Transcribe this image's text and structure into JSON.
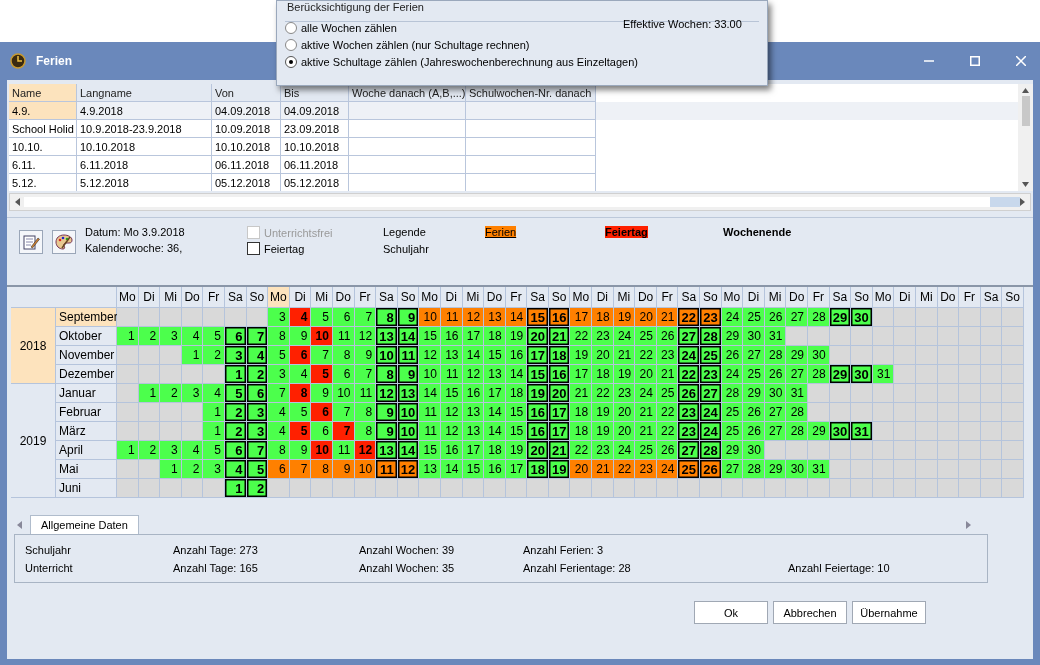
{
  "popup": {
    "title": "Berücksichtigung der Ferien",
    "effective": "Effektive Wochen: 33.00",
    "options": [
      {
        "label": "alle Wochen zählen",
        "selected": false
      },
      {
        "label": "aktive Wochen zählen (nur Schultage rechnen)",
        "selected": false
      },
      {
        "label": "aktive Schultage zählen (Jahreswochenberechnung aus Einzeltagen)",
        "selected": true
      }
    ]
  },
  "window": {
    "title": "Ferien"
  },
  "table": {
    "columns": [
      "Name",
      "Langname",
      "Von",
      "Bis",
      "Woche danach (A,B,...)",
      "Schulwochen-Nr. danach"
    ],
    "rows": [
      {
        "selected": true,
        "cells": [
          "4.9.",
          "4.9.2018",
          "04.09.2018",
          "04.09.2018"
        ]
      },
      {
        "selected": false,
        "cells": [
          "School Holid",
          "10.9.2018-23.9.2018",
          "10.09.2018",
          "23.09.2018"
        ]
      },
      {
        "selected": false,
        "cells": [
          "10.10.",
          "10.10.2018",
          "10.10.2018",
          "10.10.2018"
        ]
      },
      {
        "selected": false,
        "cells": [
          "6.11.",
          "6.11.2018",
          "06.11.2018",
          "06.11.2018"
        ]
      },
      {
        "selected": false,
        "cells": [
          "5.12.",
          "5.12.2018",
          "05.12.2018",
          "05.12.2018"
        ]
      }
    ]
  },
  "toolbar": {
    "date": "Datum: Mo 3.9.2018",
    "week": "Kalenderwoche: 36,",
    "checkboxes": [
      {
        "label": "Unterrichtsfrei",
        "checked": false,
        "disabled": true
      },
      {
        "label": "Feiertag",
        "checked": false,
        "disabled": false
      }
    ],
    "legend": [
      {
        "label": "Legende",
        "kind": "plain"
      },
      {
        "label": "Ferien",
        "kind": "holiday"
      },
      {
        "label": "Feiertag",
        "kind": "public_holiday"
      },
      {
        "label": "Wochenende",
        "kind": "weekend"
      },
      {
        "label": "Schuljahr",
        "kind": "plain"
      }
    ]
  },
  "calendar": {
    "weekdays": [
      {
        "label": "Mo",
        "selected": false
      },
      {
        "label": "Di",
        "selected": false
      },
      {
        "label": "Mi",
        "selected": false
      },
      {
        "label": "Do",
        "selected": false
      },
      {
        "label": "Fr",
        "selected": false
      },
      {
        "label": "Sa",
        "selected": false
      },
      {
        "label": "So",
        "selected": false
      },
      {
        "label": "Mo",
        "selected": true
      },
      {
        "label": "Di",
        "selected": false
      },
      {
        "label": "Mi",
        "selected": false
      },
      {
        "label": "Do",
        "selected": false
      },
      {
        "label": "Fr",
        "selected": false
      },
      {
        "label": "Sa",
        "selected": false
      },
      {
        "label": "So",
        "selected": false
      },
      {
        "label": "Mo",
        "selected": false
      },
      {
        "label": "Di",
        "selected": false
      },
      {
        "label": "Mi",
        "selected": false
      },
      {
        "label": "Do",
        "selected": false
      },
      {
        "label": "Fr",
        "selected": false
      },
      {
        "label": "Sa",
        "selected": false
      },
      {
        "label": "So",
        "selected": false
      },
      {
        "label": "Mo",
        "selected": false
      },
      {
        "label": "Di",
        "selected": false
      },
      {
        "label": "Mi",
        "selected": false
      },
      {
        "label": "Do",
        "selected": false
      },
      {
        "label": "Fr",
        "selected": false
      },
      {
        "label": "Sa",
        "selected": false
      },
      {
        "label": "So",
        "selected": false
      },
      {
        "label": "Mo",
        "selected": false
      },
      {
        "label": "Di",
        "selected": false
      },
      {
        "label": "Mi",
        "selected": false
      },
      {
        "label": "Do",
        "selected": false
      },
      {
        "label": "Fr",
        "selected": false
      },
      {
        "label": "Sa",
        "selected": false
      },
      {
        "label": "So",
        "selected": false
      },
      {
        "label": "Mo",
        "selected": false
      },
      {
        "label": "Di",
        "selected": false
      },
      {
        "label": "Mi",
        "selected": false
      },
      {
        "label": "Do",
        "selected": false
      },
      {
        "label": "Fr",
        "selected": false
      },
      {
        "label": "Sa",
        "selected": false
      },
      {
        "label": "So",
        "selected": false
      }
    ],
    "years": [
      {
        "year": "2018",
        "selected": true,
        "months": [
          {
            "name": "September",
            "selected": true,
            "cells": [
              {
                "kind": "empty"
              },
              {
                "kind": "empty"
              },
              {
                "kind": "empty"
              },
              {
                "kind": "empty"
              },
              {
                "kind": "empty"
              },
              {
                "kind": "empty"
              },
              {
                "kind": "empty"
              },
              {
                "day": "3",
                "kind": "school"
              },
              {
                "day": "4",
                "kind": "public_holiday"
              },
              {
                "day": "5",
                "kind": "school"
              },
              {
                "day": "6",
                "kind": "school"
              },
              {
                "day": "7",
                "kind": "school"
              },
              {
                "day": "8",
                "kind": "weekend"
              },
              {
                "day": "9",
                "kind": "weekend"
              },
              {
                "day": "10",
                "kind": "holiday"
              },
              {
                "day": "11",
                "kind": "holiday"
              },
              {
                "day": "12",
                "kind": "holiday"
              },
              {
                "day": "13",
                "kind": "holiday"
              },
              {
                "day": "14",
                "kind": "holiday"
              },
              {
                "day": "15",
                "kind": "holiday_weekend"
              },
              {
                "day": "16",
                "kind": "holiday_weekend"
              },
              {
                "day": "17",
                "kind": "holiday"
              },
              {
                "day": "18",
                "kind": "holiday"
              },
              {
                "day": "19",
                "kind": "holiday"
              },
              {
                "day": "20",
                "kind": "holiday"
              },
              {
                "day": "21",
                "kind": "holiday"
              },
              {
                "day": "22",
                "kind": "holiday_weekend"
              },
              {
                "day": "23",
                "kind": "holiday_weekend"
              },
              {
                "day": "24",
                "kind": "school"
              },
              {
                "day": "25",
                "kind": "school"
              },
              {
                "day": "26",
                "kind": "school"
              },
              {
                "day": "27",
                "kind": "school"
              },
              {
                "day": "28",
                "kind": "school"
              },
              {
                "day": "29",
                "kind": "weekend"
              },
              {
                "day": "30",
                "kind": "weekend"
              }
            ]
          },
          {
            "name": "Oktober",
            "selected": false,
            "cells": [
              {
                "day": "1",
                "kind": "school"
              },
              {
                "day": "2",
                "kind": "school"
              },
              {
                "day": "3",
                "kind": "school"
              },
              {
                "day": "4",
                "kind": "school"
              },
              {
                "day": "5",
                "kind": "school"
              },
              {
                "day": "6",
                "kind": "weekend"
              },
              {
                "day": "7",
                "kind": "weekend"
              },
              {
                "day": "8",
                "kind": "school"
              },
              {
                "day": "9",
                "kind": "school"
              },
              {
                "day": "10",
                "kind": "public_holiday"
              },
              {
                "day": "11",
                "kind": "school"
              },
              {
                "day": "12",
                "kind": "school"
              },
              {
                "day": "13",
                "kind": "weekend"
              },
              {
                "day": "14",
                "kind": "weekend"
              },
              {
                "day": "15",
                "kind": "school"
              },
              {
                "day": "16",
                "kind": "school"
              },
              {
                "day": "17",
                "kind": "school"
              },
              {
                "day": "18",
                "kind": "school"
              },
              {
                "day": "19",
                "kind": "school"
              },
              {
                "day": "20",
                "kind": "weekend"
              },
              {
                "day": "21",
                "kind": "weekend"
              },
              {
                "day": "22",
                "kind": "school"
              },
              {
                "day": "23",
                "kind": "school"
              },
              {
                "day": "24",
                "kind": "school"
              },
              {
                "day": "25",
                "kind": "school"
              },
              {
                "day": "26",
                "kind": "school"
              },
              {
                "day": "27",
                "kind": "weekend"
              },
              {
                "day": "28",
                "kind": "weekend"
              },
              {
                "day": "29",
                "kind": "school"
              },
              {
                "day": "30",
                "kind": "school"
              },
              {
                "day": "31",
                "kind": "school"
              }
            ]
          },
          {
            "name": "November",
            "selected": false,
            "cells": [
              {
                "kind": "empty"
              },
              {
                "kind": "empty"
              },
              {
                "kind": "empty"
              },
              {
                "day": "1",
                "kind": "school"
              },
              {
                "day": "2",
                "kind": "school"
              },
              {
                "day": "3",
                "kind": "weekend"
              },
              {
                "day": "4",
                "kind": "weekend"
              },
              {
                "day": "5",
                "kind": "school"
              },
              {
                "day": "6",
                "kind": "public_holiday"
              },
              {
                "day": "7",
                "kind": "school"
              },
              {
                "day": "8",
                "kind": "school"
              },
              {
                "day": "9",
                "kind": "school"
              },
              {
                "day": "10",
                "kind": "weekend"
              },
              {
                "day": "11",
                "kind": "weekend"
              },
              {
                "day": "12",
                "kind": "school"
              },
              {
                "day": "13",
                "kind": "school"
              },
              {
                "day": "14",
                "kind": "school"
              },
              {
                "day": "15",
                "kind": "school"
              },
              {
                "day": "16",
                "kind": "school"
              },
              {
                "day": "17",
                "kind": "weekend"
              },
              {
                "day": "18",
                "kind": "weekend"
              },
              {
                "day": "19",
                "kind": "school"
              },
              {
                "day": "20",
                "kind": "school"
              },
              {
                "day": "21",
                "kind": "school"
              },
              {
                "day": "22",
                "kind": "school"
              },
              {
                "day": "23",
                "kind": "school"
              },
              {
                "day": "24",
                "kind": "weekend"
              },
              {
                "day": "25",
                "kind": "weekend"
              },
              {
                "day": "26",
                "kind": "school"
              },
              {
                "day": "27",
                "kind": "school"
              },
              {
                "day": "28",
                "kind": "school"
              },
              {
                "day": "29",
                "kind": "school"
              },
              {
                "day": "30",
                "kind": "school"
              }
            ]
          },
          {
            "name": "Dezember",
            "selected": false,
            "cells": [
              {
                "kind": "empty"
              },
              {
                "kind": "empty"
              },
              {
                "kind": "empty"
              },
              {
                "kind": "empty"
              },
              {
                "kind": "empty"
              },
              {
                "day": "1",
                "kind": "weekend"
              },
              {
                "day": "2",
                "kind": "weekend"
              },
              {
                "day": "3",
                "kind": "school"
              },
              {
                "day": "4",
                "kind": "school"
              },
              {
                "day": "5",
                "kind": "public_holiday"
              },
              {
                "day": "6",
                "kind": "school"
              },
              {
                "day": "7",
                "kind": "school"
              },
              {
                "day": "8",
                "kind": "weekend"
              },
              {
                "day": "9",
                "kind": "weekend"
              },
              {
                "day": "10",
                "kind": "school"
              },
              {
                "day": "11",
                "kind": "school"
              },
              {
                "day": "12",
                "kind": "school"
              },
              {
                "day": "13",
                "kind": "school"
              },
              {
                "day": "14",
                "kind": "school"
              },
              {
                "day": "15",
                "kind": "weekend"
              },
              {
                "day": "16",
                "kind": "weekend"
              },
              {
                "day": "17",
                "kind": "school"
              },
              {
                "day": "18",
                "kind": "school"
              },
              {
                "day": "19",
                "kind": "school"
              },
              {
                "day": "20",
                "kind": "school"
              },
              {
                "day": "21",
                "kind": "school"
              },
              {
                "day": "22",
                "kind": "weekend"
              },
              {
                "day": "23",
                "kind": "weekend"
              },
              {
                "day": "24",
                "kind": "school"
              },
              {
                "day": "25",
                "kind": "school"
              },
              {
                "day": "26",
                "kind": "school"
              },
              {
                "day": "27",
                "kind": "school"
              },
              {
                "day": "28",
                "kind": "school"
              },
              {
                "day": "29",
                "kind": "weekend"
              },
              {
                "day": "30",
                "kind": "weekend"
              },
              {
                "day": "31",
                "kind": "school"
              }
            ]
          }
        ]
      },
      {
        "year": "2019",
        "selected": false,
        "months": [
          {
            "name": "Januar",
            "selected": false,
            "cells": [
              {
                "kind": "empty"
              },
              {
                "day": "1",
                "kind": "school"
              },
              {
                "day": "2",
                "kind": "school"
              },
              {
                "day": "3",
                "kind": "school"
              },
              {
                "day": "4",
                "kind": "school"
              },
              {
                "day": "5",
                "kind": "weekend"
              },
              {
                "day": "6",
                "kind": "weekend"
              },
              {
                "day": "7",
                "kind": "school"
              },
              {
                "day": "8",
                "kind": "public_holiday"
              },
              {
                "day": "9",
                "kind": "school"
              },
              {
                "day": "10",
                "kind": "school"
              },
              {
                "day": "11",
                "kind": "school"
              },
              {
                "day": "12",
                "kind": "weekend"
              },
              {
                "day": "13",
                "kind": "weekend"
              },
              {
                "day": "14",
                "kind": "school"
              },
              {
                "day": "15",
                "kind": "school"
              },
              {
                "day": "16",
                "kind": "school"
              },
              {
                "day": "17",
                "kind": "school"
              },
              {
                "day": "18",
                "kind": "school"
              },
              {
                "day": "19",
                "kind": "weekend"
              },
              {
                "day": "20",
                "kind": "weekend"
              },
              {
                "day": "21",
                "kind": "school"
              },
              {
                "day": "22",
                "kind": "school"
              },
              {
                "day": "23",
                "kind": "school"
              },
              {
                "day": "24",
                "kind": "school"
              },
              {
                "day": "25",
                "kind": "school"
              },
              {
                "day": "26",
                "kind": "weekend"
              },
              {
                "day": "27",
                "kind": "weekend"
              },
              {
                "day": "28",
                "kind": "school"
              },
              {
                "day": "29",
                "kind": "school"
              },
              {
                "day": "30",
                "kind": "school"
              },
              {
                "day": "31",
                "kind": "school"
              }
            ]
          },
          {
            "name": "Februar",
            "selected": false,
            "cells": [
              {
                "kind": "empty"
              },
              {
                "kind": "empty"
              },
              {
                "kind": "empty"
              },
              {
                "kind": "empty"
              },
              {
                "day": "1",
                "kind": "school"
              },
              {
                "day": "2",
                "kind": "weekend"
              },
              {
                "day": "3",
                "kind": "weekend"
              },
              {
                "day": "4",
                "kind": "school"
              },
              {
                "day": "5",
                "kind": "school"
              },
              {
                "day": "6",
                "kind": "public_holiday"
              },
              {
                "day": "7",
                "kind": "school"
              },
              {
                "day": "8",
                "kind": "school"
              },
              {
                "day": "9",
                "kind": "weekend"
              },
              {
                "day": "10",
                "kind": "weekend"
              },
              {
                "day": "11",
                "kind": "school"
              },
              {
                "day": "12",
                "kind": "school"
              },
              {
                "day": "13",
                "kind": "school"
              },
              {
                "day": "14",
                "kind": "school"
              },
              {
                "day": "15",
                "kind": "school"
              },
              {
                "day": "16",
                "kind": "weekend"
              },
              {
                "day": "17",
                "kind": "weekend"
              },
              {
                "day": "18",
                "kind": "school"
              },
              {
                "day": "19",
                "kind": "school"
              },
              {
                "day": "20",
                "kind": "school"
              },
              {
                "day": "21",
                "kind": "school"
              },
              {
                "day": "22",
                "kind": "school"
              },
              {
                "day": "23",
                "kind": "weekend"
              },
              {
                "day": "24",
                "kind": "weekend"
              },
              {
                "day": "25",
                "kind": "school"
              },
              {
                "day": "26",
                "kind": "school"
              },
              {
                "day": "27",
                "kind": "school"
              },
              {
                "day": "28",
                "kind": "school"
              }
            ]
          },
          {
            "name": "März",
            "selected": false,
            "cells": [
              {
                "kind": "empty"
              },
              {
                "kind": "empty"
              },
              {
                "kind": "empty"
              },
              {
                "kind": "empty"
              },
              {
                "day": "1",
                "kind": "school"
              },
              {
                "day": "2",
                "kind": "weekend"
              },
              {
                "day": "3",
                "kind": "weekend"
              },
              {
                "day": "4",
                "kind": "school"
              },
              {
                "day": "5",
                "kind": "public_holiday"
              },
              {
                "day": "6",
                "kind": "school"
              },
              {
                "day": "7",
                "kind": "public_holiday"
              },
              {
                "day": "8",
                "kind": "school"
              },
              {
                "day": "9",
                "kind": "weekend"
              },
              {
                "day": "10",
                "kind": "weekend"
              },
              {
                "day": "11",
                "kind": "school"
              },
              {
                "day": "12",
                "kind": "school"
              },
              {
                "day": "13",
                "kind": "school"
              },
              {
                "day": "14",
                "kind": "school"
              },
              {
                "day": "15",
                "kind": "school"
              },
              {
                "day": "16",
                "kind": "weekend"
              },
              {
                "day": "17",
                "kind": "weekend"
              },
              {
                "day": "18",
                "kind": "school"
              },
              {
                "day": "19",
                "kind": "school"
              },
              {
                "day": "20",
                "kind": "school"
              },
              {
                "day": "21",
                "kind": "school"
              },
              {
                "day": "22",
                "kind": "school"
              },
              {
                "day": "23",
                "kind": "weekend"
              },
              {
                "day": "24",
                "kind": "weekend"
              },
              {
                "day": "25",
                "kind": "school"
              },
              {
                "day": "26",
                "kind": "school"
              },
              {
                "day": "27",
                "kind": "school"
              },
              {
                "day": "28",
                "kind": "school"
              },
              {
                "day": "29",
                "kind": "school"
              },
              {
                "day": "30",
                "kind": "weekend"
              },
              {
                "day": "31",
                "kind": "weekend"
              }
            ]
          },
          {
            "name": "April",
            "selected": false,
            "cells": [
              {
                "day": "1",
                "kind": "school"
              },
              {
                "day": "2",
                "kind": "school"
              },
              {
                "day": "3",
                "kind": "school"
              },
              {
                "day": "4",
                "kind": "school"
              },
              {
                "day": "5",
                "kind": "school"
              },
              {
                "day": "6",
                "kind": "weekend"
              },
              {
                "day": "7",
                "kind": "weekend"
              },
              {
                "day": "8",
                "kind": "school"
              },
              {
                "day": "9",
                "kind": "school"
              },
              {
                "day": "10",
                "kind": "public_holiday"
              },
              {
                "day": "11",
                "kind": "school"
              },
              {
                "day": "12",
                "kind": "public_holiday"
              },
              {
                "day": "13",
                "kind": "weekend"
              },
              {
                "day": "14",
                "kind": "weekend"
              },
              {
                "day": "15",
                "kind": "school"
              },
              {
                "day": "16",
                "kind": "school"
              },
              {
                "day": "17",
                "kind": "school"
              },
              {
                "day": "18",
                "kind": "school"
              },
              {
                "day": "19",
                "kind": "school"
              },
              {
                "day": "20",
                "kind": "weekend"
              },
              {
                "day": "21",
                "kind": "weekend"
              },
              {
                "day": "22",
                "kind": "school"
              },
              {
                "day": "23",
                "kind": "school"
              },
              {
                "day": "24",
                "kind": "school"
              },
              {
                "day": "25",
                "kind": "school"
              },
              {
                "day": "26",
                "kind": "school"
              },
              {
                "day": "27",
                "kind": "weekend"
              },
              {
                "day": "28",
                "kind": "weekend"
              },
              {
                "day": "29",
                "kind": "school"
              },
              {
                "day": "30",
                "kind": "school"
              }
            ]
          },
          {
            "name": "Mai",
            "selected": false,
            "cells": [
              {
                "kind": "empty"
              },
              {
                "kind": "empty"
              },
              {
                "day": "1",
                "kind": "school"
              },
              {
                "day": "2",
                "kind": "school"
              },
              {
                "day": "3",
                "kind": "school"
              },
              {
                "day": "4",
                "kind": "weekend"
              },
              {
                "day": "5",
                "kind": "weekend"
              },
              {
                "day": "6",
                "kind": "holiday"
              },
              {
                "day": "7",
                "kind": "holiday"
              },
              {
                "day": "8",
                "kind": "holiday"
              },
              {
                "day": "9",
                "kind": "holiday"
              },
              {
                "day": "10",
                "kind": "holiday"
              },
              {
                "day": "11",
                "kind": "holiday_weekend"
              },
              {
                "day": "12",
                "kind": "holiday_weekend"
              },
              {
                "day": "13",
                "kind": "school"
              },
              {
                "day": "14",
                "kind": "school"
              },
              {
                "day": "15",
                "kind": "school"
              },
              {
                "day": "16",
                "kind": "school"
              },
              {
                "day": "17",
                "kind": "school"
              },
              {
                "day": "18",
                "kind": "weekend"
              },
              {
                "day": "19",
                "kind": "weekend"
              },
              {
                "day": "20",
                "kind": "holiday"
              },
              {
                "day": "21",
                "kind": "holiday"
              },
              {
                "day": "22",
                "kind": "holiday"
              },
              {
                "day": "23",
                "kind": "holiday"
              },
              {
                "day": "24",
                "kind": "holiday"
              },
              {
                "day": "25",
                "kind": "holiday_weekend"
              },
              {
                "day": "26",
                "kind": "holiday_weekend"
              },
              {
                "day": "27",
                "kind": "school"
              },
              {
                "day": "28",
                "kind": "school"
              },
              {
                "day": "29",
                "kind": "school"
              },
              {
                "day": "30",
                "kind": "school"
              },
              {
                "day": "31",
                "kind": "school"
              }
            ]
          },
          {
            "name": "Juni",
            "selected": false,
            "cells": [
              {
                "kind": "empty"
              },
              {
                "kind": "empty"
              },
              {
                "kind": "empty"
              },
              {
                "kind": "empty"
              },
              {
                "kind": "empty"
              },
              {
                "day": "1",
                "kind": "weekend"
              },
              {
                "day": "2",
                "kind": "weekend"
              }
            ]
          }
        ]
      }
    ]
  },
  "tabs": [
    {
      "label": "Allgemeine Daten",
      "selected": true
    }
  ],
  "stats": [
    {
      "label": "Schuljahr",
      "items": [
        "Anzahl Tage: 273",
        "Anzahl Wochen: 39",
        "Anzahl Ferien: 3"
      ]
    },
    {
      "label": "Unterricht",
      "items": [
        "Anzahl Tage: 165",
        "Anzahl Wochen: 35",
        "Anzahl Ferientage: 28",
        "Anzahl Feiertage: 10"
      ]
    }
  ],
  "buttons": [
    "Ok",
    "Abbrechen",
    "Übernahme"
  ]
}
